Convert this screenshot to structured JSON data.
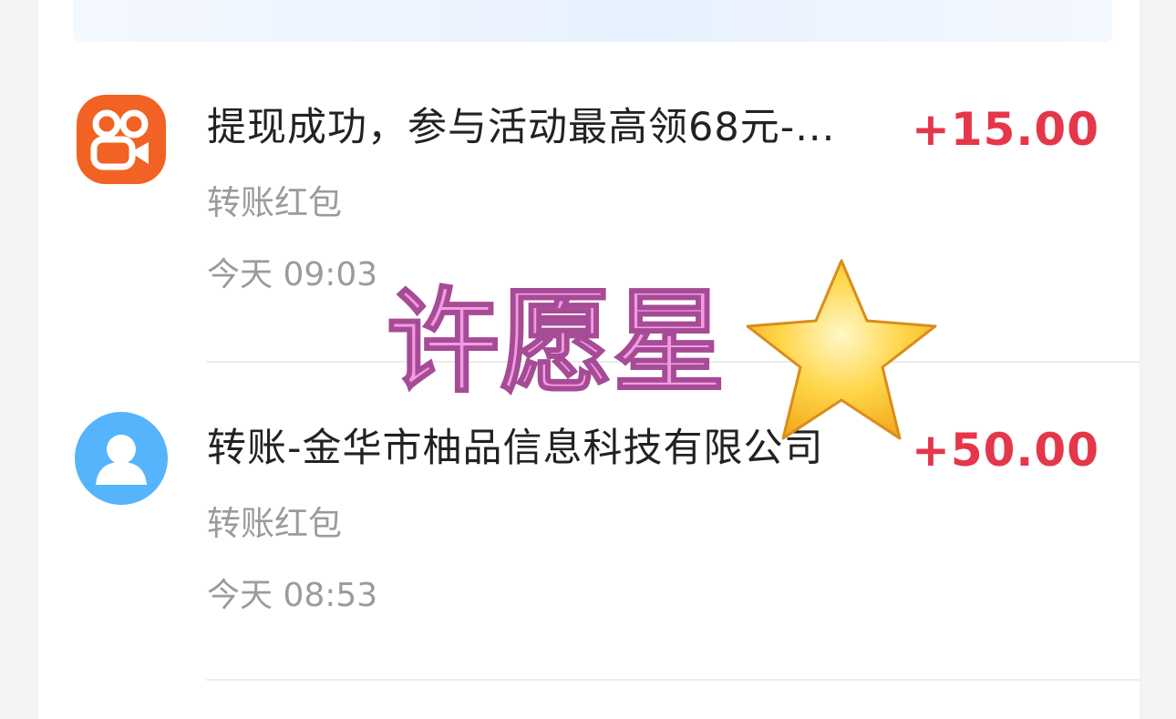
{
  "transactions": [
    {
      "title": "提现成功，参与活动最高领68元-...",
      "amount": "+15.00",
      "type": "转账红包",
      "time": "今天 09:03",
      "icon": "kuaishou-app-icon"
    },
    {
      "title": "转账-金华市柚品信息科技有限公司",
      "amount": "+50.00",
      "type": "转账红包",
      "time": "今天 08:53",
      "icon": "user-avatar-icon"
    }
  ],
  "watermark": {
    "text": "许愿星",
    "icon": "star-icon"
  },
  "colors": {
    "amount": "#e5364a",
    "app_icon_orange": "#f16224",
    "avatar_blue": "#55b4fb",
    "watermark_pink": "#f39be2"
  }
}
